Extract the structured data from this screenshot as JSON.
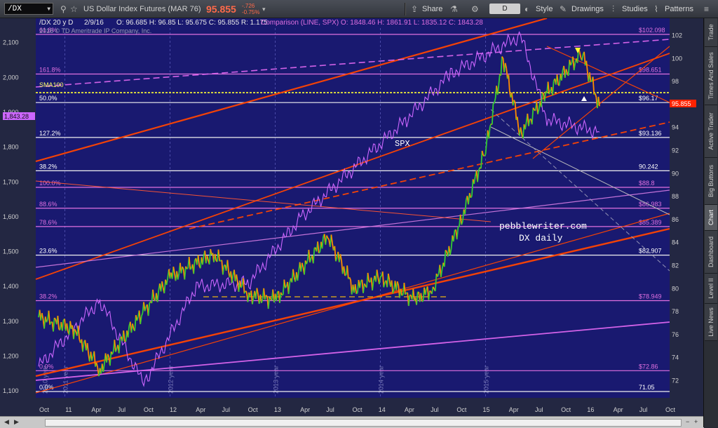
{
  "toolbar": {
    "symbol": "/DX",
    "instrument": "US Dollar Index Futures (MAR 76)",
    "last_price": "95.855",
    "net_change": "-.726",
    "pct_change": "-0.75%",
    "period": "D",
    "buttons": {
      "share": "Share",
      "style": "Style",
      "drawings": "Drawings",
      "studies": "Studies",
      "patterns": "Patterns"
    }
  },
  "header": {
    "title_line": "/DX 20 y D",
    "date": "2/9/16",
    "ohlc": "O: 96.685  H: 96.85  L: 95.675  C: 95.855  R: 1.175",
    "comparison": "Comparison (LINE, SPX)  O: 1848.46  H: 1861.91  L: 1835.12  C: 1843.28",
    "copyright": "2016 © TD Ameritrade IP Company, Inc."
  },
  "sidebar_tabs": [
    "Trade",
    "Times And Sales",
    "Active Trader",
    "Big Buttons",
    "Chart",
    "Dashboard",
    "Level II",
    "Live News"
  ],
  "sidebar_active": "Chart",
  "colors": {
    "background": "#191970",
    "grid": "#3a3a9c",
    "orange": "#ff4500",
    "magenta": "#e070e0",
    "white": "#f0f0f0",
    "yellow": "#ffff33",
    "dx_candles_up": "#33cc33",
    "dx_candles_down": "#ff8c00",
    "spx_line": "#cc66ff",
    "gray": "#9a9ab8"
  },
  "chart_data": {
    "type": "line",
    "series": [
      {
        "name": "SPX",
        "x": [
          "2010-10",
          "2011-05",
          "2011-10",
          "2012-04",
          "2012-10",
          "2013-04",
          "2013-10",
          "2014-04",
          "2014-09",
          "2015-05",
          "2015-08",
          "2016-02"
        ],
        "values": [
          1170,
          1360,
          1120,
          1400,
          1410,
          1600,
          1740,
          1880,
          2010,
          2120,
          1880,
          1843
        ]
      },
      {
        "name": "DX",
        "x": [
          "2010-10",
          "2011-02",
          "2011-05",
          "2011-10",
          "2012-01",
          "2012-06",
          "2012-10",
          "2013-01",
          "2013-07",
          "2013-10",
          "2014-01",
          "2014-05",
          "2014-07",
          "2014-10",
          "2015-01",
          "2015-03",
          "2015-05",
          "2015-08",
          "2015-12",
          "2016-02"
        ],
        "values": [
          77.5,
          76.5,
          73.0,
          78.0,
          81.0,
          83.0,
          79.5,
          79.0,
          84.5,
          80.0,
          81.0,
          79.0,
          80.0,
          85.5,
          92.0,
          100.0,
          93.5,
          97.0,
          100.5,
          95.855
        ]
      }
    ],
    "right_axis": {
      "ticks": [
        72,
        74,
        76,
        78,
        80,
        82,
        84,
        86,
        88,
        90,
        92,
        94,
        96,
        98,
        100,
        102
      ],
      "ylim": [
        70.5,
        103.5
      ]
    },
    "left_axis": {
      "ticks": [
        1100,
        1200,
        1300,
        1400,
        1500,
        1600,
        1700,
        1800,
        1900,
        2000,
        2100
      ],
      "ylim": [
        1080,
        2170
      ]
    },
    "x_labels": [
      "Oct",
      "11",
      "Apr",
      "Jul",
      "Oct",
      "12",
      "Apr",
      "Jul",
      "Oct",
      "13",
      "Apr",
      "Jul",
      "Oct",
      "14",
      "Apr",
      "Jul",
      "Oct",
      "15",
      "Apr",
      "Jul",
      "Oct",
      "16",
      "Apr",
      "Jul",
      "Oct"
    ],
    "year_markers": [
      "2010 year",
      "2011 year",
      "2012 year",
      "2013 year",
      "2014 year",
      "2015 year"
    ],
    "fib_levels": [
      {
        "label": "0.0%",
        "value": 71.05,
        "price": "71.05"
      },
      {
        "label": "0.0%",
        "value": 72.86,
        "price": "$72.86"
      },
      {
        "label": "38.2%",
        "value": 78.949,
        "price": "$78.949"
      },
      {
        "label": "78.6%",
        "value": 85.389,
        "price": "$85.389"
      },
      {
        "label": "88.6%",
        "value": 86.983,
        "price": "$86.983"
      },
      {
        "label": "100.0%",
        "value": 88.8,
        "price": "$88.8"
      },
      {
        "label": "38.2%",
        "value": 90.242,
        "price": "90.242"
      },
      {
        "label": "127.2%",
        "value": 93.136,
        "price": "$93.136"
      },
      {
        "label": "50.0%",
        "value": 96.17,
        "price": "$96.17"
      },
      {
        "label": "161.8%",
        "value": 98.651,
        "price": "$98.651"
      },
      {
        "label": "61.8%",
        "value": 102.098,
        "price": "$102.098"
      },
      {
        "label": "23.6%",
        "value": 82.907,
        "price": "$82.907"
      }
    ],
    "sma_label": "SMA100",
    "sma_value": 97.029,
    "last_label": "95.855",
    "spx_last": "1,843.28",
    "annotations": {
      "spx": "SPX",
      "credit_site": "pebblewriter.com",
      "credit_sub": "DX daily"
    }
  }
}
